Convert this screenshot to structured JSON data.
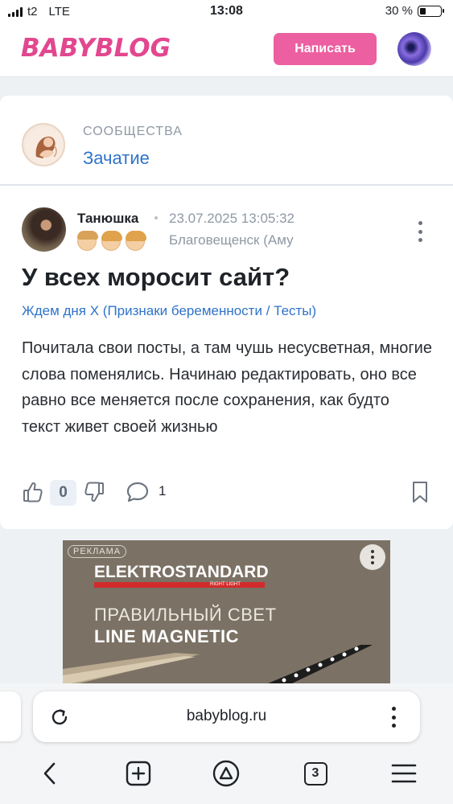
{
  "status_bar": {
    "carrier": "t2",
    "network": "LTE",
    "time": "13:08",
    "battery": "30 %",
    "battery_level": 0.3
  },
  "header": {
    "logo": "BABYBLOG",
    "write_button": "Написать"
  },
  "community": {
    "caption": "СООБЩЕСТВА",
    "name": "Зачатие"
  },
  "post": {
    "author": "Танюшка",
    "date": "23.07.2025 13:05:32",
    "city": "Благовещенск (Аму",
    "title": "У всех моросит сайт?",
    "tag": "Ждем дня Х (Признаки беременности / Тесты)",
    "body": "Почитала свои посты, а там чушь несусветная, многие слова поменялись. Начинаю редактировать, оно все равно все меняется после сохранения, как будто текст живет своей жизнью",
    "likes": "0",
    "comments": "1"
  },
  "ad": {
    "label": "РЕКЛАМА",
    "brand": "ELEKTROSTANDARD",
    "brand_sub": "RIGHT LIGHT",
    "line1": "ПРАВИЛЬНЫЙ СВЕТ",
    "line2": "LINE MAGNETIC"
  },
  "browser": {
    "url": "babyblog.ru",
    "tabs_count": "3"
  },
  "colors": {
    "brand_pink": "#e2478f",
    "button_pink": "#ec5fa0",
    "link_blue": "#2f73c9"
  }
}
